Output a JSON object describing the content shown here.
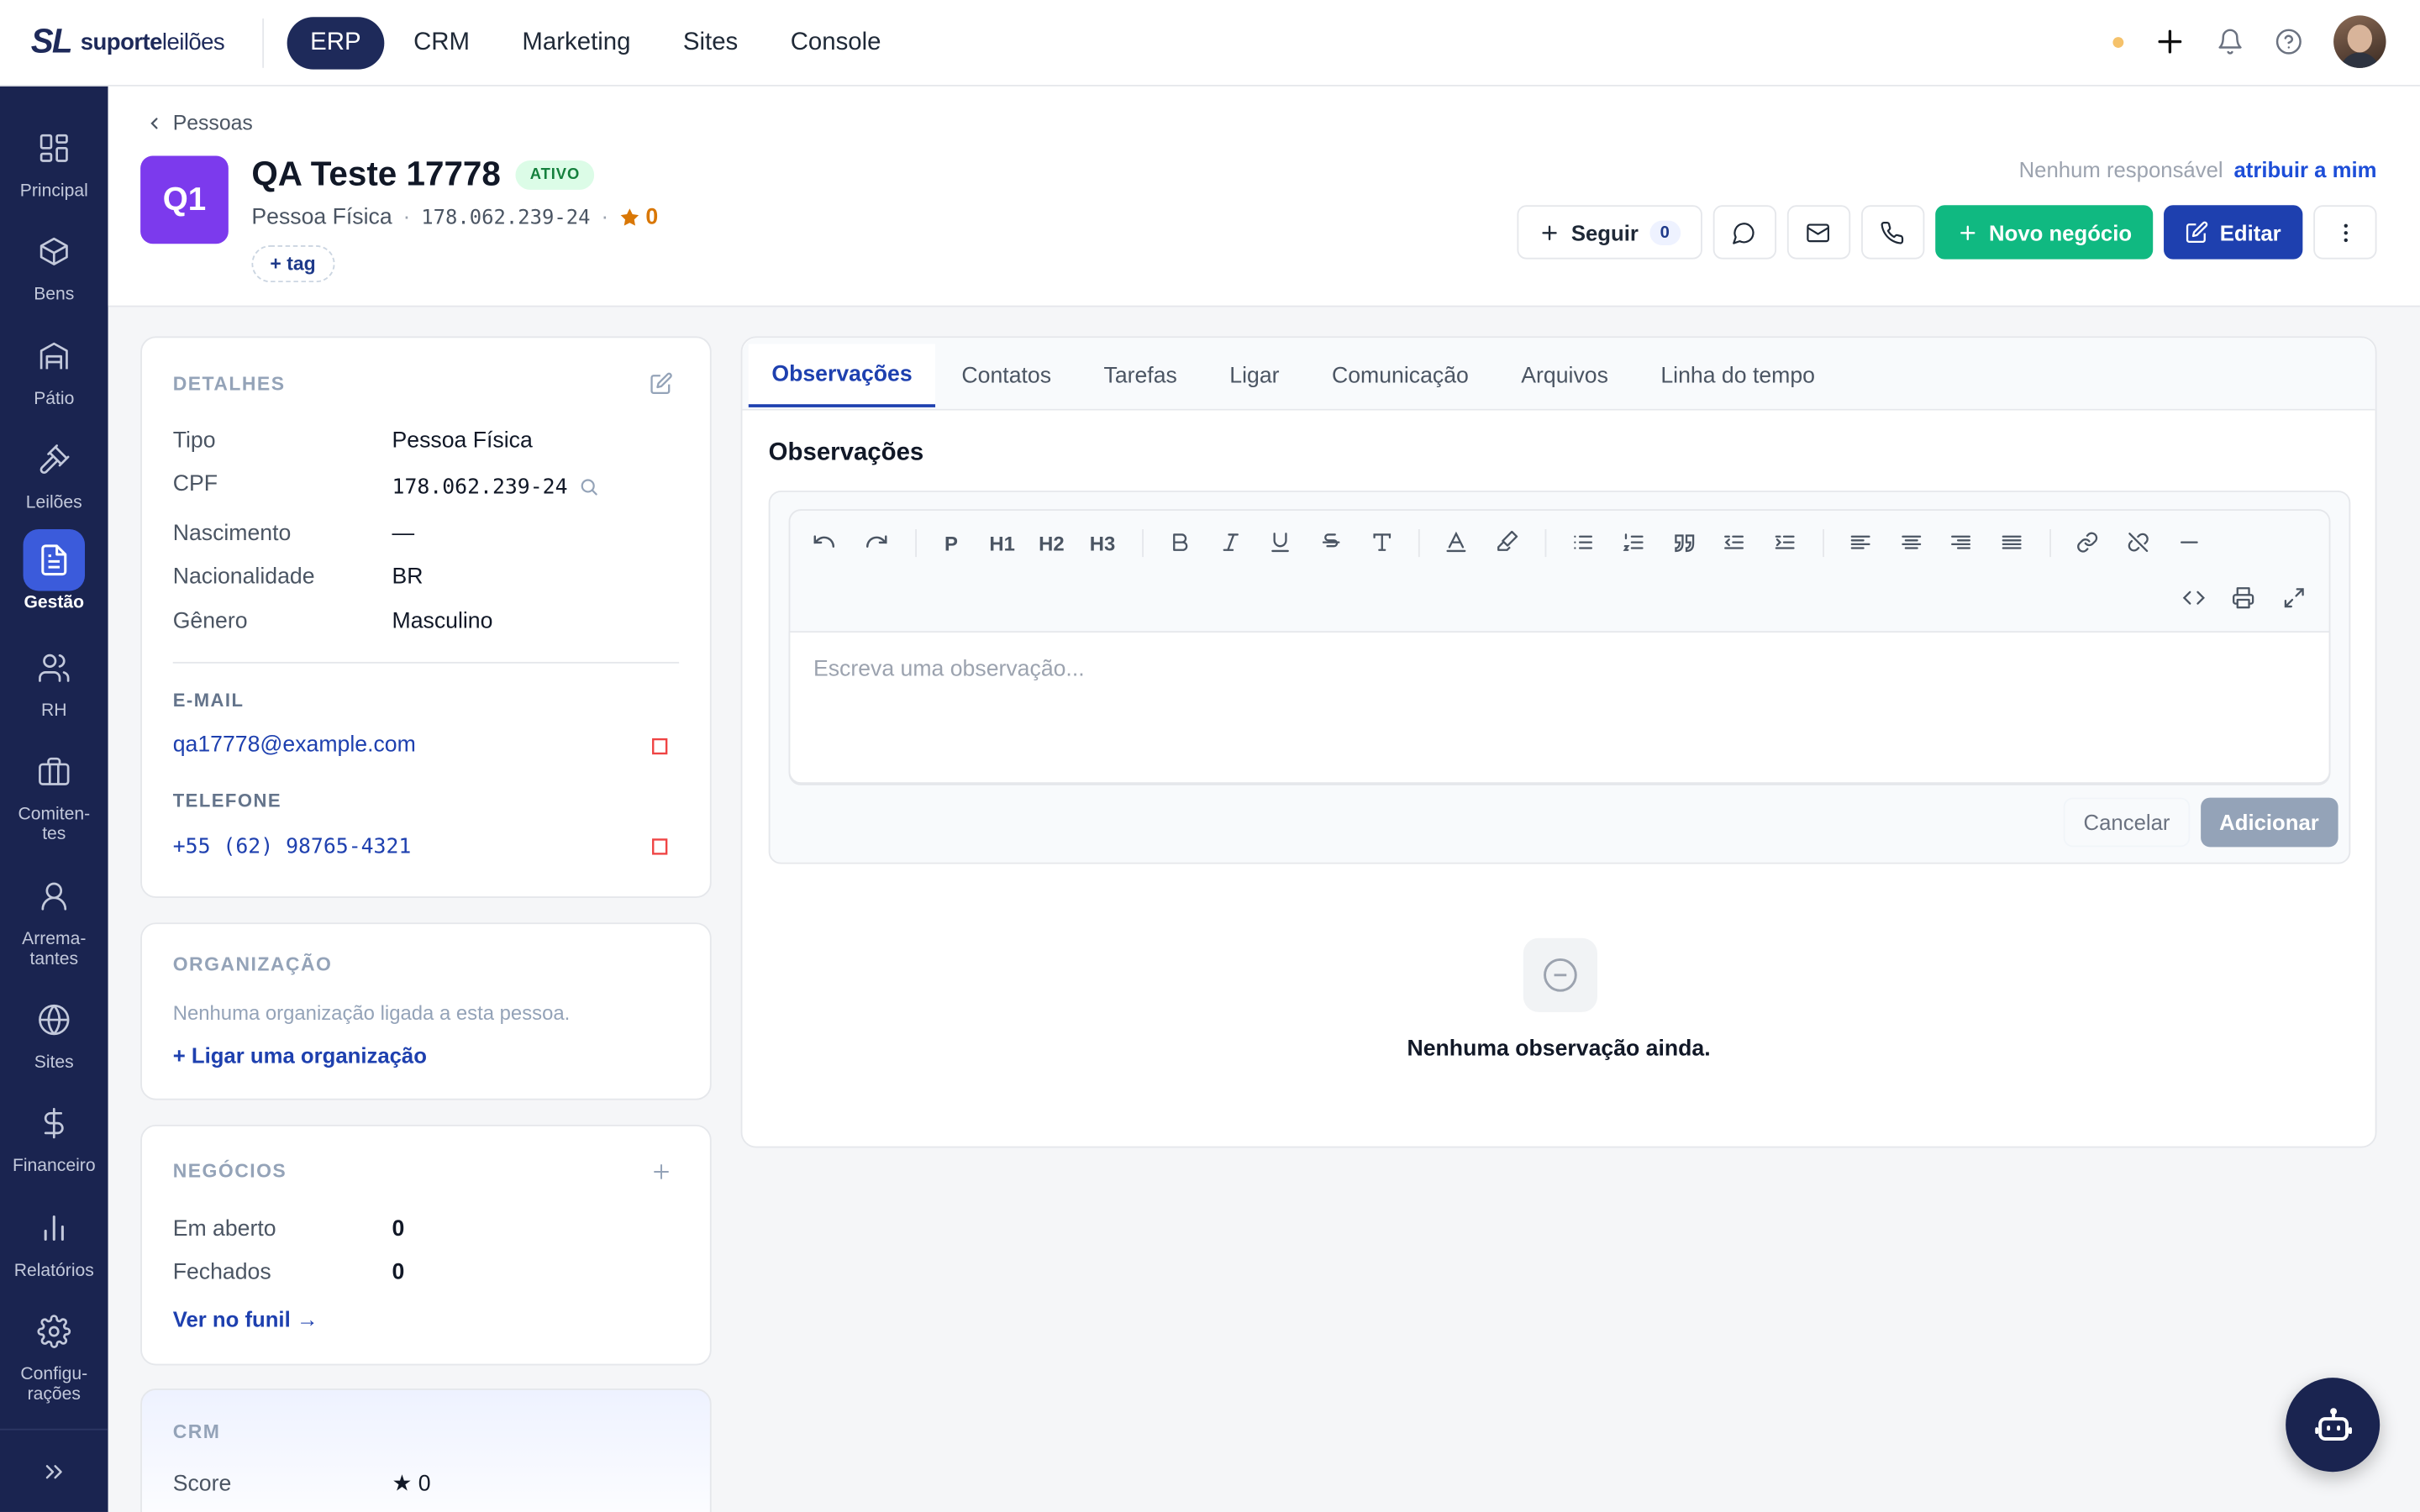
{
  "brand": {
    "mark": "SL",
    "name_bold": "suporte",
    "name_light": "leilões"
  },
  "topnav": [
    {
      "label": "ERP",
      "active": true
    },
    {
      "label": "CRM",
      "active": false
    },
    {
      "label": "Marketing",
      "active": false
    },
    {
      "label": "Sites",
      "active": false
    },
    {
      "label": "Console",
      "active": false
    }
  ],
  "sidebar": [
    {
      "label": "Principal",
      "icon": "grid-icon"
    },
    {
      "label": "Bens",
      "icon": "box-icon"
    },
    {
      "label": "Pátio",
      "icon": "warehouse-icon"
    },
    {
      "label": "Leilões",
      "icon": "gavel-icon"
    },
    {
      "label": "Gestão",
      "icon": "document-icon",
      "active": true
    },
    {
      "label": "RH",
      "icon": "users-icon"
    },
    {
      "label": "Comiten-\ntes",
      "icon": "briefcase-icon"
    },
    {
      "label": "Arrema-\ntantes",
      "icon": "user-icon"
    },
    {
      "label": "Sites",
      "icon": "globe-icon"
    },
    {
      "label": "Financeiro",
      "icon": "dollar-icon"
    },
    {
      "label": "Relatórios",
      "icon": "bar-chart-icon"
    },
    {
      "label": "Configu-\nrações",
      "icon": "settings-icon"
    }
  ],
  "breadcrumb": "Pessoas",
  "person": {
    "initials": "Q1",
    "name": "QA Teste 17778",
    "status": "ATIVO",
    "type": "Pessoa Física",
    "cpf": "178.062.239-24",
    "score": "0",
    "add_tag": "+ tag"
  },
  "responsible": {
    "label": "Nenhum responsável",
    "action": "atribuir a mim"
  },
  "actions": {
    "follow": "Seguir",
    "follow_count": "0",
    "new_deal": "Novo negócio",
    "edit": "Editar"
  },
  "details": {
    "title": "DETALHES",
    "rows": [
      {
        "label": "Tipo",
        "value": "Pessoa Física"
      },
      {
        "label": "CPF",
        "value": "178.062.239-24"
      },
      {
        "label": "Nascimento",
        "value": "—"
      },
      {
        "label": "Nacionalidade",
        "value": "BR"
      },
      {
        "label": "Gênero",
        "value": "Masculino"
      }
    ],
    "email_title": "E-MAIL",
    "email": "qa17778@example.com",
    "phone_title": "TELEFONE",
    "phone": "+55 (62) 98765-4321"
  },
  "organization": {
    "title": "ORGANIZAÇÃO",
    "empty": "Nenhuma organização ligada a esta pessoa.",
    "link": "+ Ligar uma organização"
  },
  "deals": {
    "title": "NEGÓCIOS",
    "open_label": "Em aberto",
    "open_value": "0",
    "closed_label": "Fechados",
    "closed_value": "0",
    "link": "Ver no funil →"
  },
  "crm": {
    "title": "CRM",
    "score_label": "Score",
    "score_value": "★ 0"
  },
  "tabs": [
    {
      "label": "Observações",
      "active": true
    },
    {
      "label": "Contatos"
    },
    {
      "label": "Tarefas"
    },
    {
      "label": "Ligar"
    },
    {
      "label": "Comunicação"
    },
    {
      "label": "Arquivos"
    },
    {
      "label": "Linha do tempo"
    }
  ],
  "notes": {
    "heading": "Observações",
    "toolbar_text": [
      "P",
      "H1",
      "H2",
      "H3"
    ],
    "placeholder": "Escreva uma observação...",
    "cancel": "Cancelar",
    "add": "Adicionar",
    "empty": "Nenhuma observação ainda."
  }
}
